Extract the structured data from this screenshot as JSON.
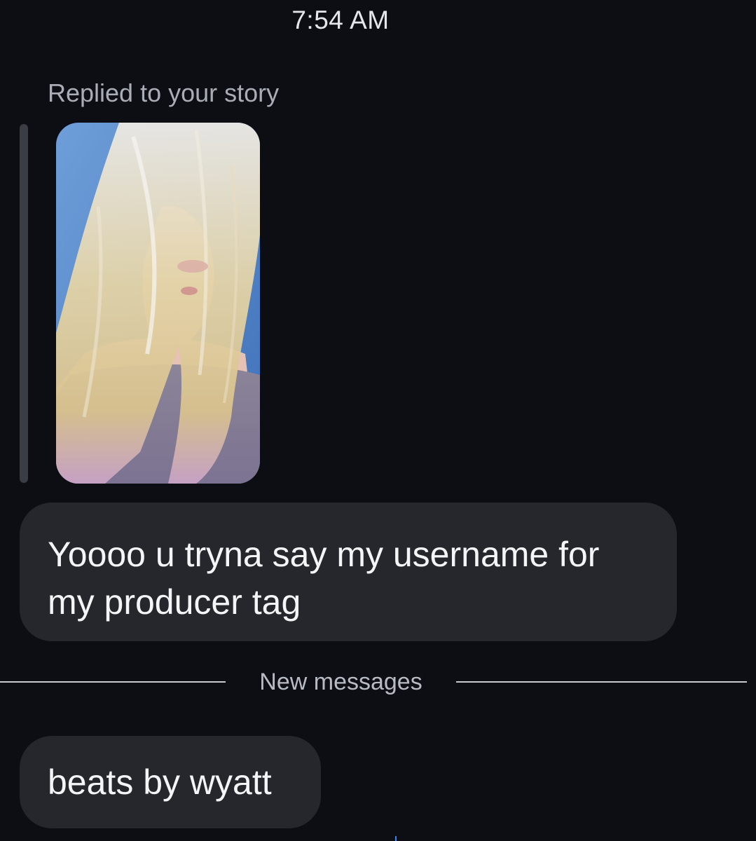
{
  "header": {
    "time": "7:54 AM"
  },
  "thread": {
    "reply_context": {
      "label": "Replied to your story",
      "story_image": "story-photo"
    },
    "messages": [
      {
        "text": "Yoooo u tryna say my username for my producer tag"
      }
    ],
    "divider": {
      "label": "New messages"
    },
    "new_messages": [
      {
        "text": "beats by wyatt"
      }
    ]
  },
  "colors": {
    "background": "#0c0e14",
    "bubble": "#25272c",
    "reply_bar": "#3a3d44",
    "divider_line": "#c7cad0"
  }
}
